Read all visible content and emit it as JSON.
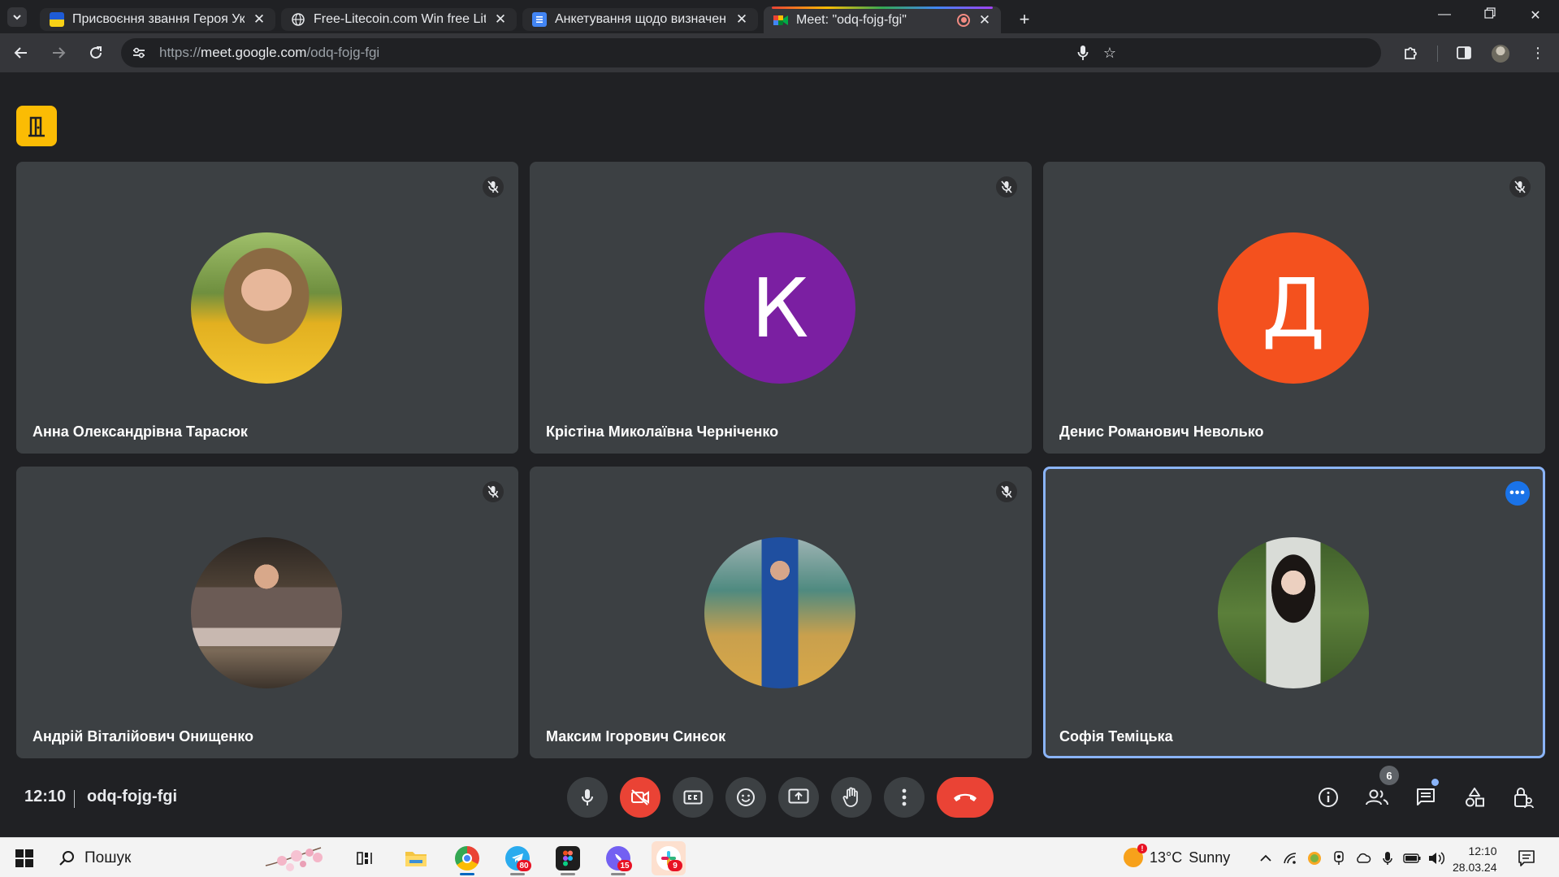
{
  "browser": {
    "tabs": [
      {
        "title": "Присвоєння звання Героя Укр",
        "favicon": "ukraine-trident-icon",
        "active": false
      },
      {
        "title": "Free-Litecoin.com Win free Lite",
        "favicon": "globe-icon",
        "active": false
      },
      {
        "title": "Анкетування щодо визначенн",
        "favicon": "google-forms-icon",
        "active": false
      },
      {
        "title": "Meet: \"odq-fojg-fgi\"",
        "favicon": "google-meet-icon",
        "active": true,
        "recording": true
      }
    ],
    "url": {
      "protocol": "https://",
      "host": "meet.google.com",
      "path": "/odq-fojg-fgi"
    }
  },
  "meet": {
    "participants": [
      {
        "name": "Анна Олександрівна Тарасюк",
        "avatar_type": "photo",
        "muted": true
      },
      {
        "name": "Крістіна Миколаївна Черніченко",
        "avatar_type": "initial",
        "initial": "К",
        "color": "#7b1fa2",
        "muted": true
      },
      {
        "name": "Денис Романович Неволько",
        "avatar_type": "initial",
        "initial": "Д",
        "color": "#f4511e",
        "muted": true
      },
      {
        "name": "Андрій Віталійович Онищенко",
        "avatar_type": "photo",
        "muted": true
      },
      {
        "name": "Максим Ігорович Синєок",
        "avatar_type": "photo",
        "muted": true
      },
      {
        "name": "Софія Теміцька",
        "avatar_type": "photo",
        "muted": false,
        "selected": true
      }
    ],
    "call_time": "12:10",
    "meeting_code": "odq-fojg-fgi",
    "people_count": "6",
    "accent_red": "#ea4335",
    "accent_blue": "#8ab4f8"
  },
  "taskbar": {
    "search_label": "Пошук",
    "apps": [
      {
        "name": "task-view",
        "badge": ""
      },
      {
        "name": "file-explorer",
        "badge": ""
      },
      {
        "name": "chrome",
        "badge": ""
      },
      {
        "name": "telegram",
        "badge": "80"
      },
      {
        "name": "figma",
        "badge": ""
      },
      {
        "name": "viber",
        "badge": "15"
      },
      {
        "name": "slack",
        "badge": "9"
      }
    ],
    "weather": {
      "temp": "13°C",
      "condition": "Sunny",
      "alert": "!"
    },
    "clock": {
      "time": "12:10",
      "date": "28.03.24"
    }
  }
}
